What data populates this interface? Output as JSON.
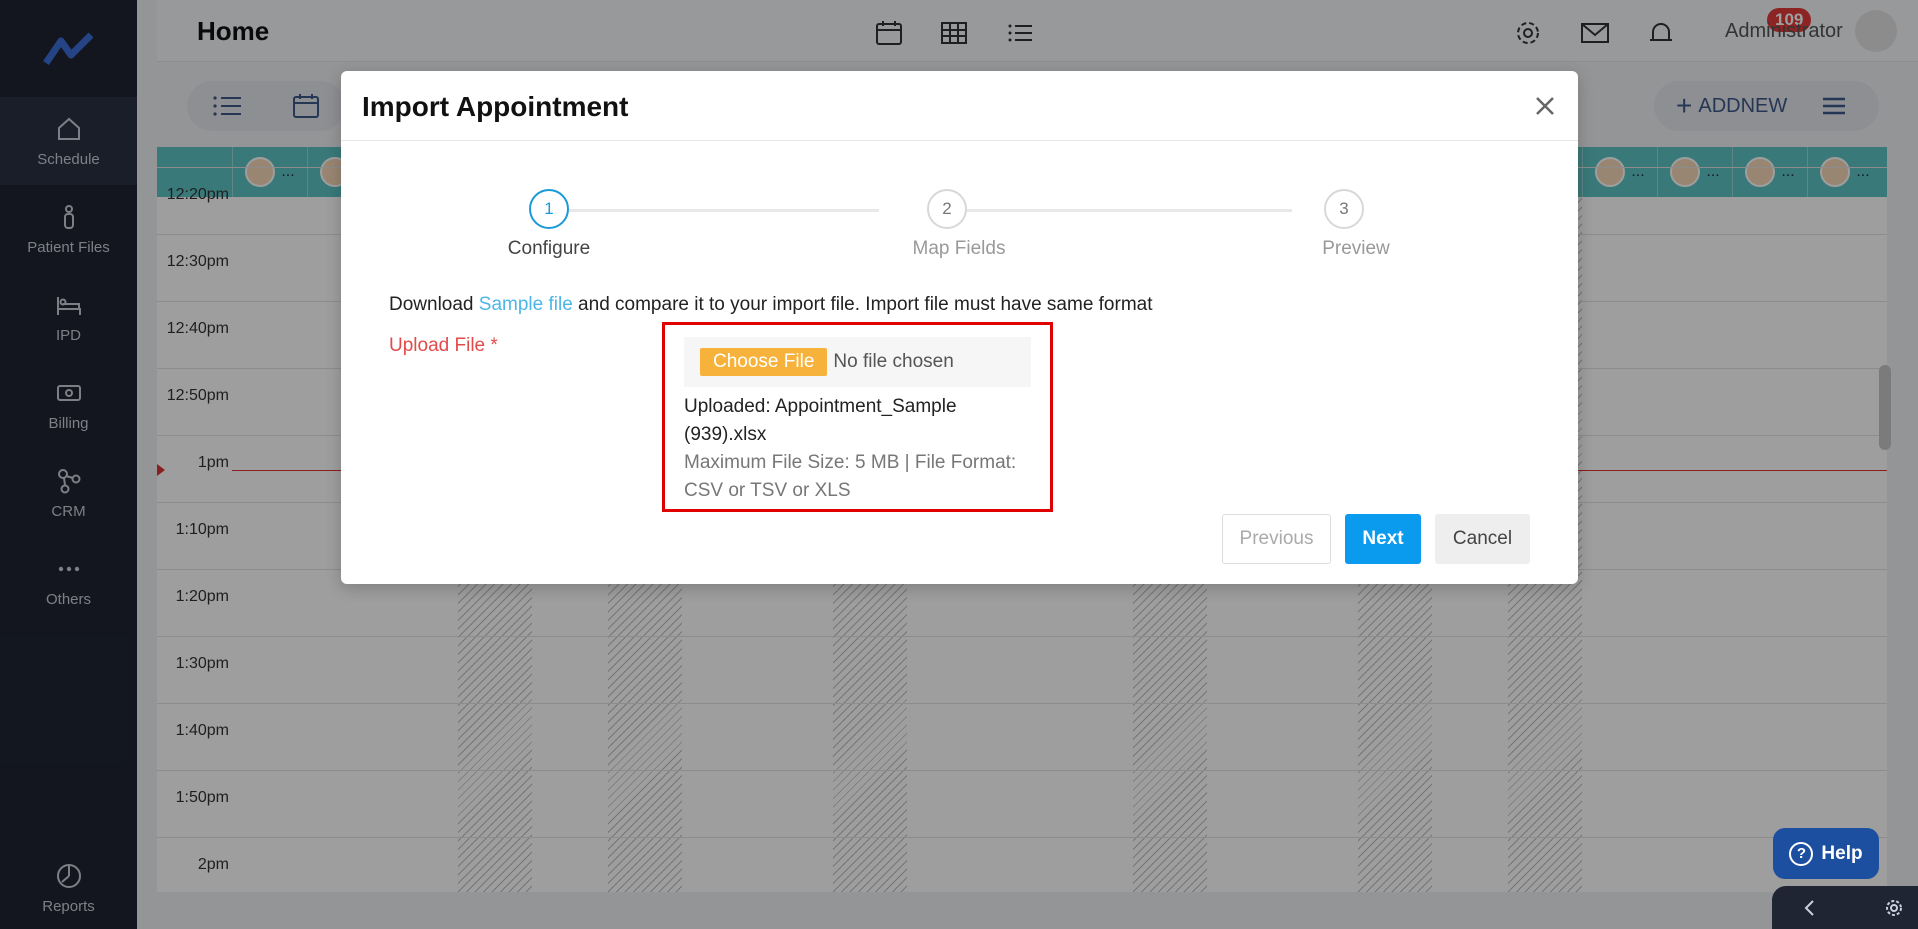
{
  "sidebar": {
    "items": [
      {
        "label": "Schedule",
        "icon": "home-icon"
      },
      {
        "label": "Patient Files",
        "icon": "person-icon"
      },
      {
        "label": "IPD",
        "icon": "bed-icon"
      },
      {
        "label": "Billing",
        "icon": "money-icon"
      },
      {
        "label": "CRM",
        "icon": "network-icon"
      },
      {
        "label": "Others",
        "icon": "more-dots-icon"
      }
    ],
    "bottom": {
      "label": "Reports",
      "icon": "pie-chart-icon"
    }
  },
  "header": {
    "title": "Home",
    "notification_count": "109",
    "user_name": "Administrator"
  },
  "toolbar": {
    "add_new_label": "ADDNEW"
  },
  "calendar": {
    "time_labels": [
      "12:20pm",
      "12:30pm",
      "12:40pm",
      "12:50pm",
      "1pm",
      "1:10pm",
      "1:20pm",
      "1:30pm",
      "1:40pm",
      "1:50pm",
      "2pm"
    ],
    "resource_more": "..."
  },
  "modal": {
    "title": "Import Appointment",
    "steps": [
      {
        "number": "1",
        "label": "Configure"
      },
      {
        "number": "2",
        "label": "Map Fields"
      },
      {
        "number": "3",
        "label": "Preview"
      }
    ],
    "download_prefix": "Download ",
    "sample_link": "Sample file",
    "download_suffix": " and compare it to your import file. Import file must have same format",
    "upload_label": "Upload File *",
    "choose_file": "Choose File",
    "no_file": "No file chosen",
    "uploaded_text": "Uploaded: Appointment_Sample (939).xlsx",
    "max_info": "Maximum File Size: 5 MB | File Format: CSV or TSV or XLS",
    "buttons": {
      "previous": "Previous",
      "next": "Next",
      "cancel": "Cancel"
    }
  },
  "help": {
    "label": "Help"
  }
}
